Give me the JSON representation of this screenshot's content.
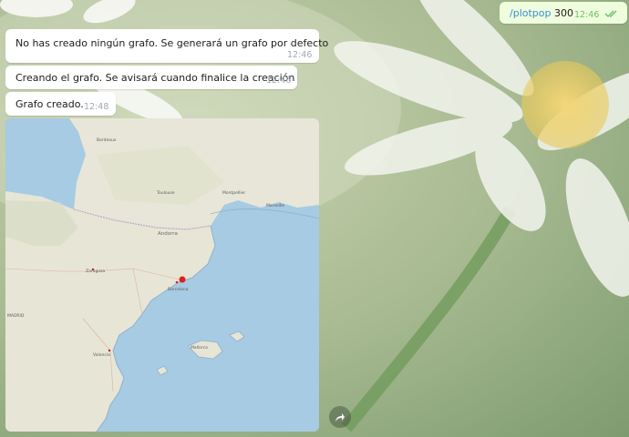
{
  "chat": {
    "messages": [
      {
        "direction": "out",
        "command": "/plotpop",
        "argument": "300",
        "time": "12:46",
        "status": "read"
      },
      {
        "direction": "in",
        "text": "No has creado ningún grafo. Se generará un grafo por defecto",
        "time": "12:46"
      },
      {
        "direction": "in",
        "text": "Creando el grafo. Se avisará cuando finalice la creación",
        "time": "12:46"
      },
      {
        "direction": "in",
        "text": "Grafo creado.",
        "time": "12:48"
      }
    ],
    "photo": {
      "labels": {
        "andorra": "Andorra",
        "madrid": "MADRID",
        "toulouse": "Toulouse",
        "montpellier": "Montpellier",
        "marseille": "Marseille",
        "bordeaux": "Bordeaux",
        "barcelona": "Barcelona",
        "valencia": "Valencia",
        "zaragoza": "Zaragoza",
        "mallorca": "Mallorca"
      }
    }
  },
  "colors": {
    "incoming_bubble": "#ffffff",
    "outgoing_bubble": "#effdde",
    "command_link": "#3a8fd1",
    "read_checks": "#6dc263",
    "map_sea": "#a6cbe3",
    "map_land": "#e7e5d6",
    "map_marker": "#e0201f"
  },
  "icons": {
    "read_status": "double-check-icon",
    "share": "share-arrow-icon"
  }
}
